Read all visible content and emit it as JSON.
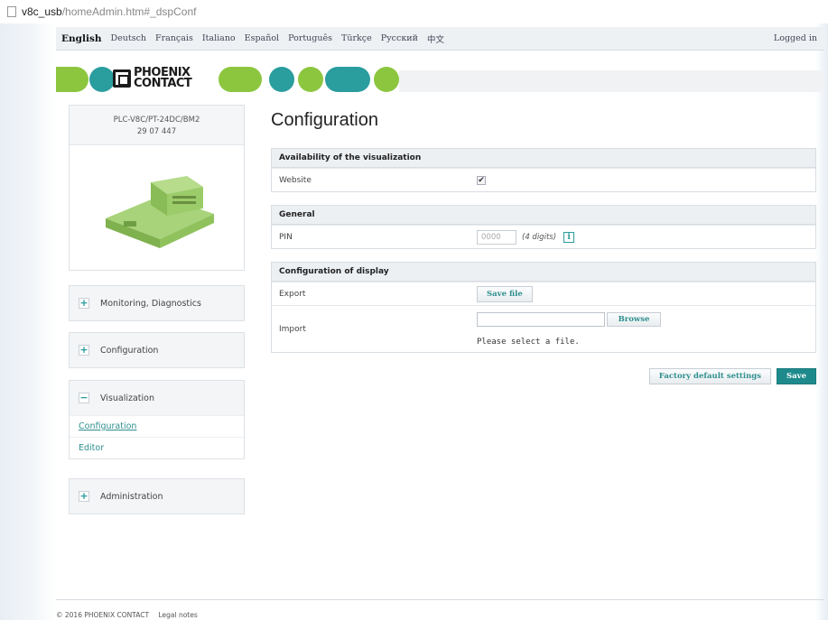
{
  "browser": {
    "url_host": "v8c_usb",
    "url_path": "/homeAdmin.htm#_dspConf"
  },
  "languages": [
    {
      "label": "English",
      "active": true
    },
    {
      "label": "Deutsch"
    },
    {
      "label": "Français"
    },
    {
      "label": "Italiano"
    },
    {
      "label": "Español"
    },
    {
      "label": "Português"
    },
    {
      "label": "Türkçe"
    },
    {
      "label": "Русский"
    },
    {
      "label": "中文"
    }
  ],
  "session": {
    "status": "Logged in"
  },
  "brand": {
    "line1": "PHOENIX",
    "line2": "CONTACT",
    "green": "#8cc63f",
    "teal": "#2a9d9e"
  },
  "device": {
    "model": "PLC-V8C/PT-24DC/BM2",
    "article": "29 07 447"
  },
  "nav": {
    "monitoring": "Monitoring, Diagnostics",
    "configuration": "Configuration",
    "visualization": "Visualization",
    "visualization_items": [
      "Configuration",
      "Editor"
    ],
    "administration": "Administration"
  },
  "main": {
    "title": "Configuration",
    "availability": {
      "header": "Availability of the visualization",
      "website_label": "Website",
      "website_checked": true
    },
    "general": {
      "header": "General",
      "pin_label": "PIN",
      "pin_placeholder": "0000",
      "pin_hint": "(4 digits)"
    },
    "display": {
      "header": "Configuration of display",
      "export_label": "Export",
      "save_file": "Save file",
      "import_label": "Import",
      "browse": "Browse",
      "import_status": "Please select a file."
    },
    "factory_button": "Factory default settings",
    "save_button": "Save"
  },
  "footer": {
    "copyright": "© 2016 PHOENIX CONTACT",
    "legal": "Legal notes"
  }
}
